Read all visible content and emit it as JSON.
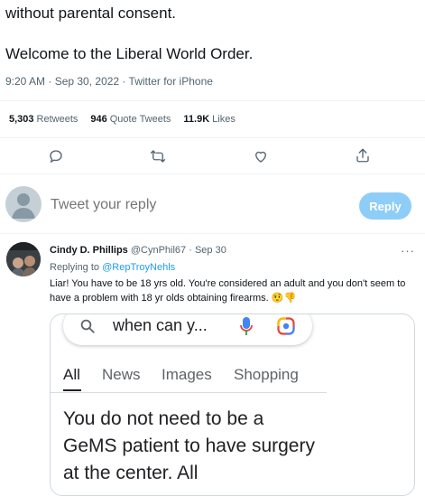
{
  "tweet": {
    "text_line1": "without parental consent.",
    "text_line2": "Welcome to the Liberal World Order.",
    "meta": "9:20 AM · Sep 30, 2022 · Twitter for iPhone"
  },
  "stats": {
    "retweets_count": "5,303",
    "retweets_label": "Retweets",
    "quotes_count": "946",
    "quotes_label": "Quote Tweets",
    "likes_count": "11.9K",
    "likes_label": "Likes"
  },
  "actions": [
    "reply-icon",
    "retweet-icon",
    "like-icon",
    "share-icon"
  ],
  "compose": {
    "placeholder": "Tweet your reply",
    "button_label": "Reply"
  },
  "reply": {
    "name": "Cindy D. Phillips",
    "handle": "@CynPhil67",
    "separator": "·",
    "date": "Sep 30",
    "more": "···",
    "replying_prefix": "Replying to",
    "replying_handle": "@RepTroyNehls",
    "text": "Liar! You have to be 18 yrs old. You're considered an adult and you don't seem to have a problem with 18 yr olds obtaining firearms. 🤨👎",
    "media": {
      "search_query": "when can y...",
      "tabs": [
        "All",
        "News",
        "Images",
        "Shopping"
      ],
      "body": "You do not need to be a GeMS patient to have surgery at the center. All"
    }
  },
  "colors": {
    "accent": "#1d9bf0",
    "reply_button_disabled": "#8ecdf8",
    "secondary_text": "#536471"
  }
}
